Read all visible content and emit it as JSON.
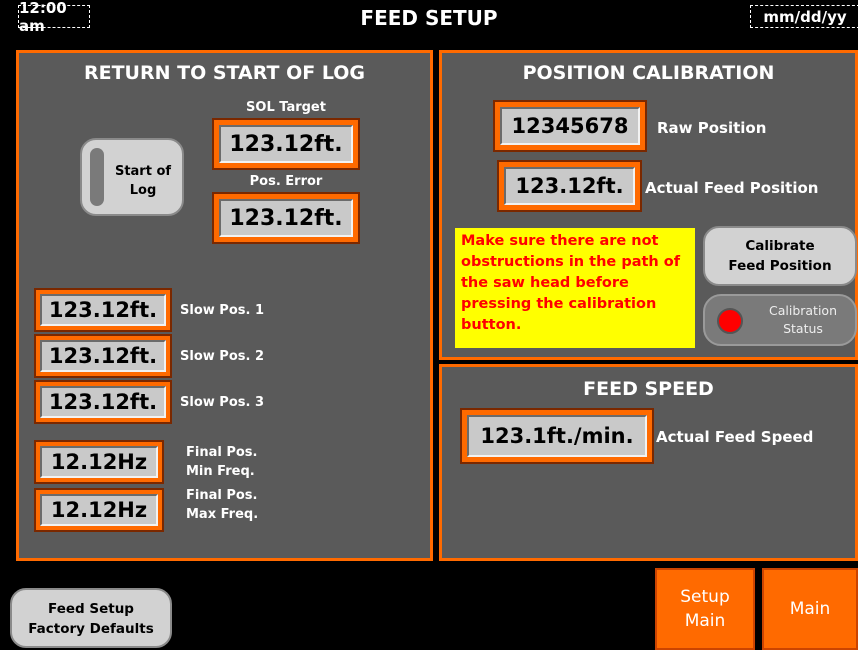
{
  "header": {
    "title": "FEED SETUP",
    "time": "12:00 am",
    "date": "mm/dd/yy"
  },
  "return_panel": {
    "title": "RETURN TO START OF LOG",
    "start_button": {
      "line1": "Start of",
      "line2": "Log"
    },
    "sol_target": {
      "label": "SOL Target",
      "value": "123.12ft."
    },
    "pos_error": {
      "label": "Pos. Error",
      "value": "123.12ft."
    },
    "slow_positions": [
      {
        "value": "123.12ft.",
        "label": "Slow Pos. 1"
      },
      {
        "value": "123.12ft.",
        "label": "Slow Pos. 2"
      },
      {
        "value": "123.12ft.",
        "label": "Slow Pos. 3"
      }
    ],
    "final_min": {
      "value": "12.12Hz",
      "line1": "Final Pos.",
      "line2": "Min Freq."
    },
    "final_max": {
      "value": "12.12Hz",
      "line1": "Final Pos.",
      "line2": "Max Freq."
    }
  },
  "calibration_panel": {
    "title": "POSITION CALIBRATION",
    "raw_position": {
      "value": "12345678",
      "label": "Raw Position"
    },
    "actual_feed_position": {
      "value": "123.12ft.",
      "label": "Actual Feed Position"
    },
    "warning": "Make sure there are not obstructions in the path of the saw head before pressing the calibration button.",
    "calibrate_button": {
      "line1": "Calibrate",
      "line2": "Feed Position"
    },
    "status": {
      "line1": "Calibration",
      "line2": "Status",
      "indicator_color": "#ff0000"
    }
  },
  "speed_panel": {
    "title": "FEED SPEED",
    "actual_feed_speed": {
      "value": "123.1ft./min.",
      "label": "Actual Feed Speed"
    }
  },
  "bottom": {
    "factory_defaults": {
      "line1": "Feed Setup",
      "line2": "Factory Defaults"
    },
    "setup_main": {
      "line1": "Setup",
      "line2": "Main"
    },
    "main": "Main"
  },
  "colors": {
    "accent": "#ff6a00",
    "panel": "#5a5a5a",
    "warning_bg": "#ffff00",
    "warning_text": "#ff0000"
  }
}
